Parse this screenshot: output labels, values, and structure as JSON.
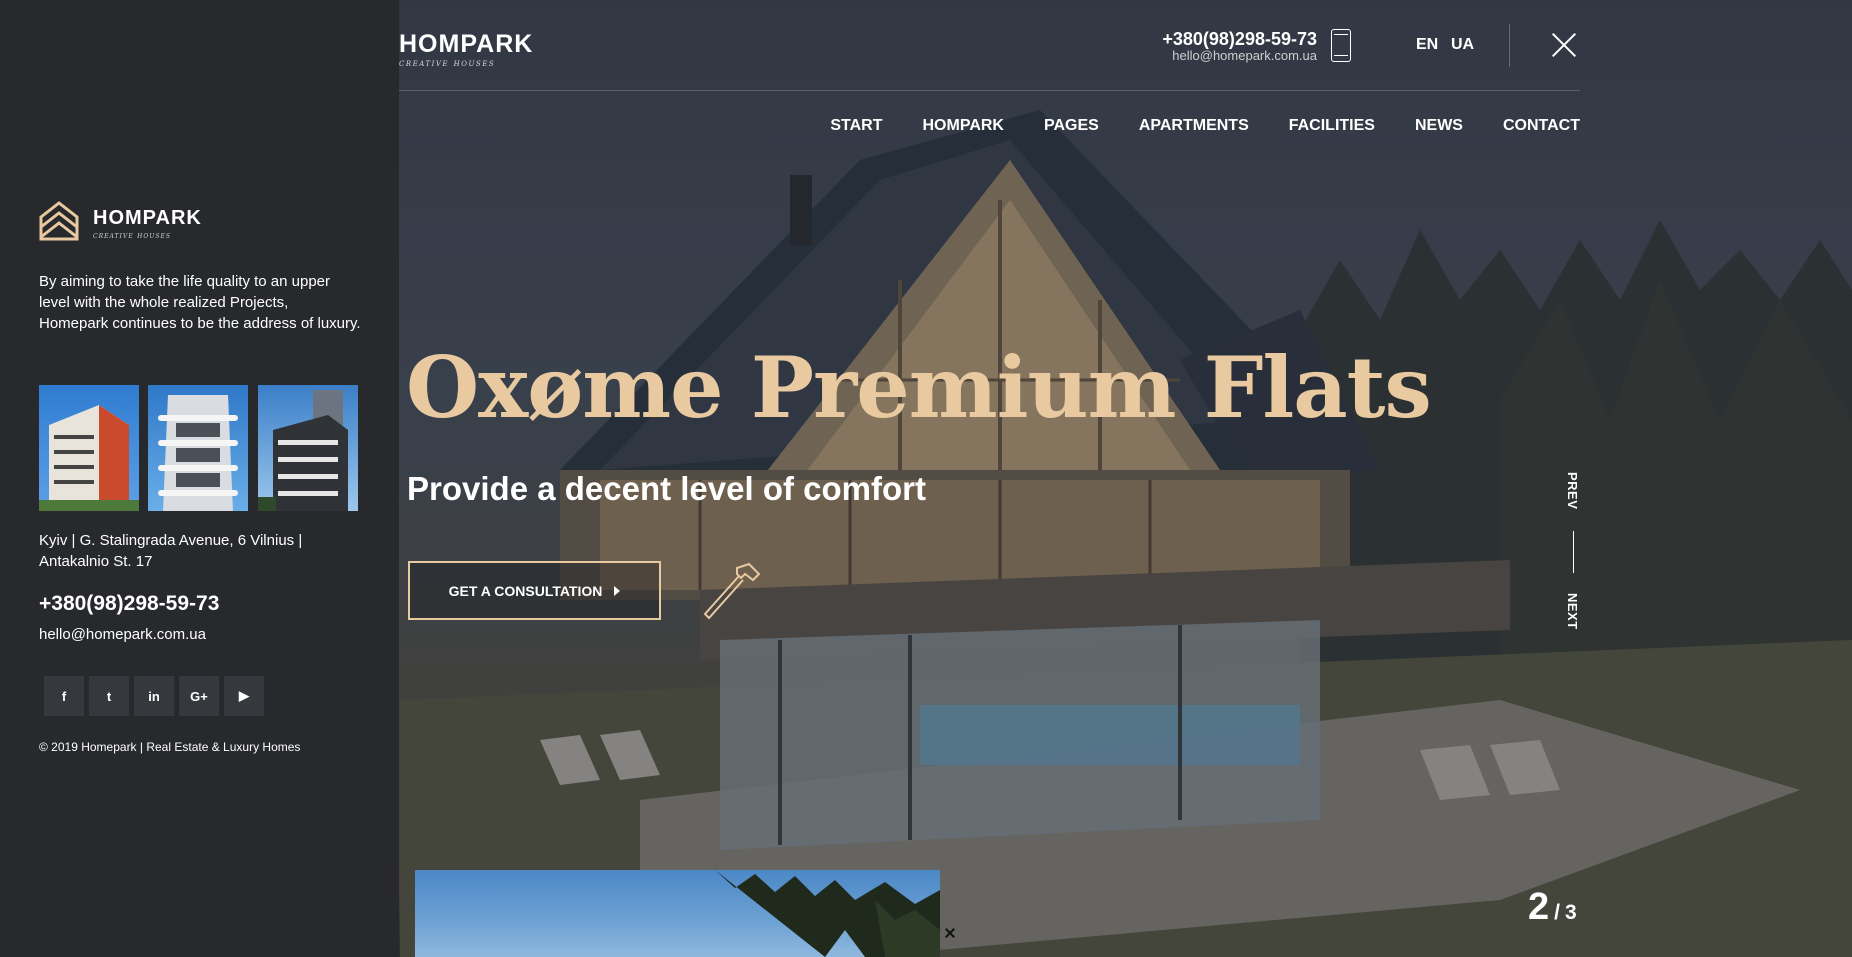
{
  "header": {
    "logo_text": "HOMPARK",
    "logo_sub": "creative houses",
    "phone": "+380(98)298-59-73",
    "email": "hello@homepark.com.ua",
    "languages": [
      "EN",
      "UA"
    ],
    "nav": [
      "START",
      "HOMPARK",
      "PAGES",
      "APARTMENTS",
      "FACILITIES",
      "NEWS",
      "CONTACT"
    ]
  },
  "hero": {
    "title": "Oxøme Premium Flats",
    "subtitle": "Provide a decent level of comfort",
    "cta_label": "GET A CONSULTATION"
  },
  "slider": {
    "prev": "PREV",
    "next": "NEXT",
    "current": "2",
    "separator": "/",
    "total": "3"
  },
  "side_panel": {
    "logo_text": "HOMPARK",
    "logo_sub": "creative houses",
    "description": "By aiming to take the life quality to an upper level with the whole realized Projects, Homepark continues to be the address of luxury.",
    "address": "Kyiv | G. Stalingrada Avenue, 6 Vilnius | Antakalnio St. 17",
    "phone": "+380(98)298-59-73",
    "email": "hello@homepark.com.ua",
    "socials": [
      "f",
      "t",
      "in",
      "G+",
      "▶"
    ],
    "copyright": "© 2019 Homepark | Real Estate & Luxury Homes"
  },
  "colors": {
    "accent": "#e8c9a0",
    "panel_bg": "#27292d",
    "social_bg": "#35383d"
  },
  "icons": [
    "phone-icon",
    "close-icon",
    "hammer-icon",
    "arrow-right-icon",
    "logo-icon",
    "facebook-icon",
    "twitter-icon",
    "linkedin-icon",
    "google-plus-icon",
    "youtube-icon"
  ]
}
